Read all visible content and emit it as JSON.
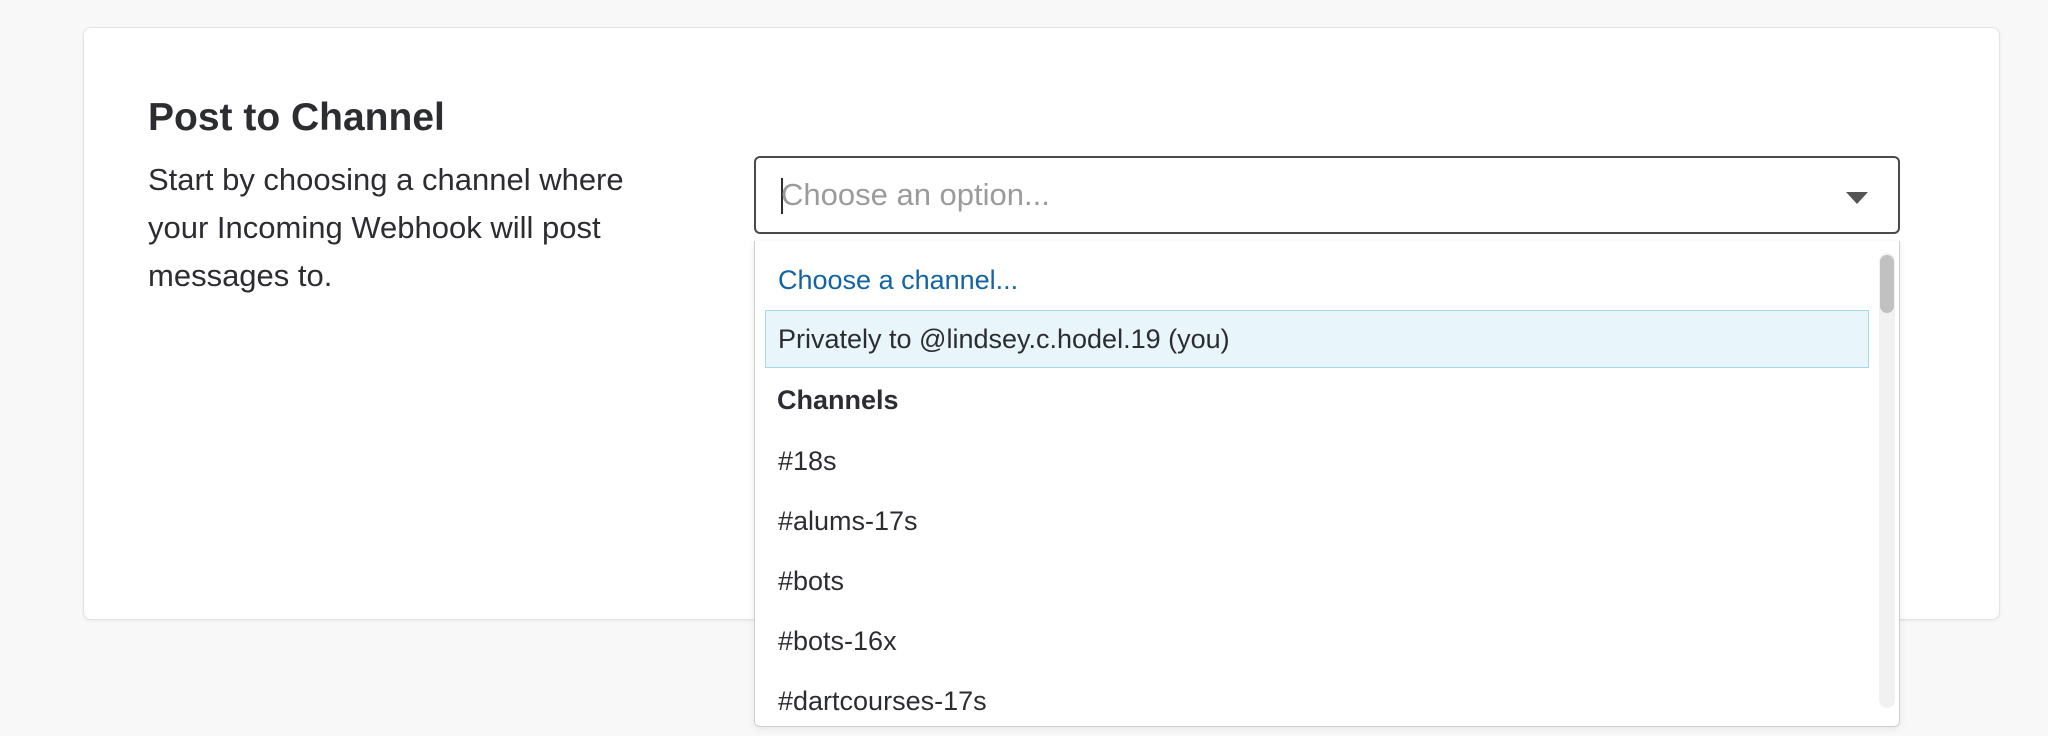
{
  "section": {
    "title": "Post to Channel",
    "description": "Start by choosing a channel where your Incoming Webhook will post messages to."
  },
  "select": {
    "placeholder": "Choose an option..."
  },
  "dropdown": {
    "prompt": "Choose a channel...",
    "private_option": "Privately to @lindsey.c.hodel.19 (you)",
    "group_label": "Channels",
    "channels": [
      "#18s",
      "#alums-17s",
      "#bots",
      "#bots-16x",
      "#dartcourses-17s"
    ]
  },
  "colors": {
    "link": "#1264a3",
    "highlight_bg": "#e8f5fa",
    "highlight_border": "#a6d8ec"
  }
}
